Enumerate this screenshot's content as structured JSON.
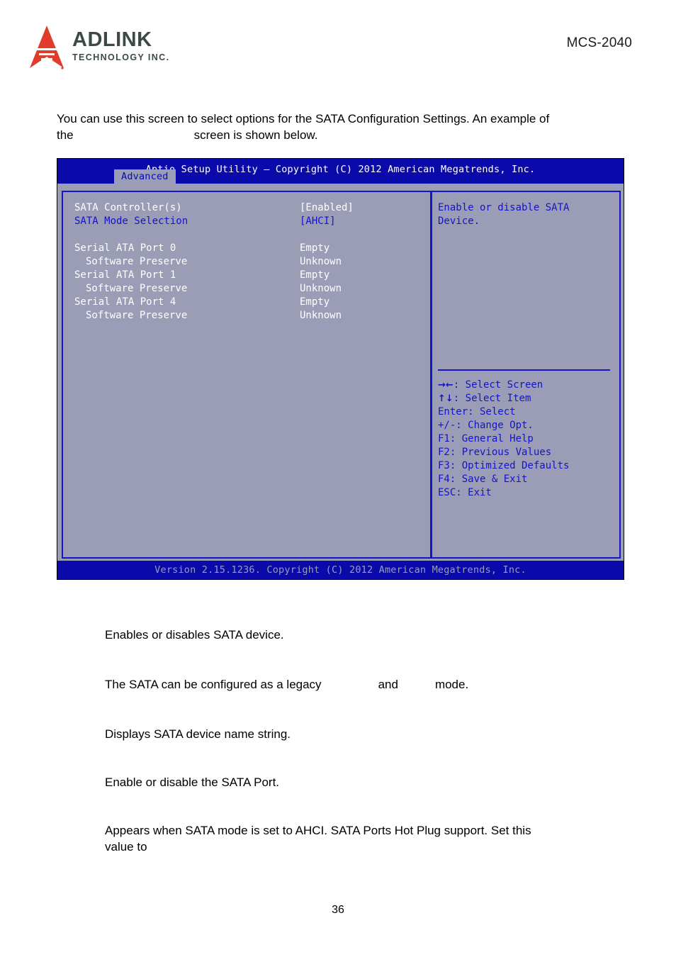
{
  "header": {
    "logo_name": "ADLINK",
    "logo_sub": "TECHNOLOGY INC.",
    "model": "MCS-2040"
  },
  "intro": {
    "line1": "You can use this screen to select options for the SATA Configuration Settings. An example of",
    "line2_before": "the",
    "line2_after": "screen is shown below."
  },
  "bios": {
    "titlebar": "Aptio Setup Utility – Copyright (C) 2012 American Megatrends, Inc.",
    "tab": "Advanced",
    "rows": [
      {
        "label": "SATA Controller(s)",
        "value": "[Enabled]",
        "color": "white",
        "indent": false
      },
      {
        "label": "SATA Mode Selection",
        "value": "[AHCI]",
        "color": "blue",
        "indent": false
      },
      {
        "label": "",
        "value": "",
        "color": "white",
        "indent": false
      },
      {
        "label": "Serial ATA Port 0",
        "value": "Empty",
        "color": "white",
        "indent": false
      },
      {
        "label": "Software Preserve",
        "value": "Unknown",
        "color": "white",
        "indent": true
      },
      {
        "label": "Serial ATA Port 1",
        "value": "Empty",
        "color": "white",
        "indent": false
      },
      {
        "label": "Software Preserve",
        "value": "Unknown",
        "color": "white",
        "indent": true
      },
      {
        "label": "Serial ATA Port 4",
        "value": "Empty",
        "color": "white",
        "indent": false
      },
      {
        "label": "Software Preserve",
        "value": "Unknown",
        "color": "white",
        "indent": true
      }
    ],
    "help_text": "Enable or disable SATA Device.",
    "keys": [
      {
        "glyph": "→←",
        "text": ": Select Screen"
      },
      {
        "glyph": "↑↓",
        "text": ": Select Item"
      },
      {
        "glyph": "",
        "text": "Enter: Select"
      },
      {
        "glyph": "",
        "text": "+/-: Change Opt."
      },
      {
        "glyph": "",
        "text": "F1: General Help"
      },
      {
        "glyph": "",
        "text": "F2: Previous Values"
      },
      {
        "glyph": "",
        "text": "F3: Optimized Defaults"
      },
      {
        "glyph": "",
        "text": "F4: Save & Exit"
      },
      {
        "glyph": "",
        "text": "ESC: Exit"
      }
    ],
    "footer": "Version 2.15.1236. Copyright (C) 2012 American Megatrends, Inc."
  },
  "descriptions": {
    "d1": "Enables or disables SATA device.",
    "d2_a": "The SATA can be configured as a legacy",
    "d2_b": "and",
    "d2_c": "mode.",
    "d3": "Displays SATA device name string.",
    "d4": "Enable or disable the SATA Port.",
    "d5_line1": "Appears when SATA mode is set to AHCI. SATA Ports Hot Plug support. Set this",
    "d5_line2": "value to"
  },
  "page_number": "36",
  "colors": {
    "bios_bg": "#9a9db5",
    "bios_blue": "#0a0aaa",
    "bios_border_blue": "#1414c8",
    "bios_white": "#ffffff",
    "logo_red": "#e03c2c",
    "logo_text": "#3c4a46"
  }
}
